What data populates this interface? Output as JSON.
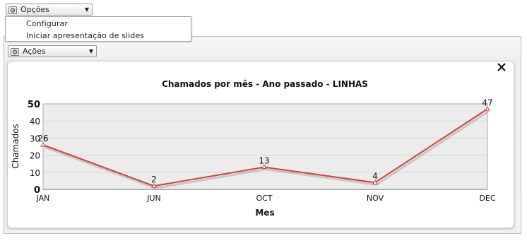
{
  "toolbar": {
    "options_label": "Opções",
    "actions_label": "Ações"
  },
  "options_menu": {
    "items": [
      "Configurar",
      "Iniciar apresentação de slides"
    ]
  },
  "chart_data": {
    "type": "line",
    "title": "Chamados por mês - Ano passado - LINHAS",
    "xlabel": "Mes",
    "ylabel": "Chamados",
    "categories": [
      "JAN",
      "JUN",
      "OCT",
      "NOV",
      "DEC"
    ],
    "series": [
      {
        "values": [
          26,
          2,
          13,
          4,
          47
        ]
      }
    ],
    "ylim": [
      0,
      50
    ],
    "yticks": [
      0,
      10,
      20,
      30,
      40,
      50
    ],
    "grid": true,
    "data_labels": true,
    "colors": {
      "line": "#d2403c",
      "plot_bg": "#ececec",
      "grid": "#d6d6d6"
    }
  }
}
